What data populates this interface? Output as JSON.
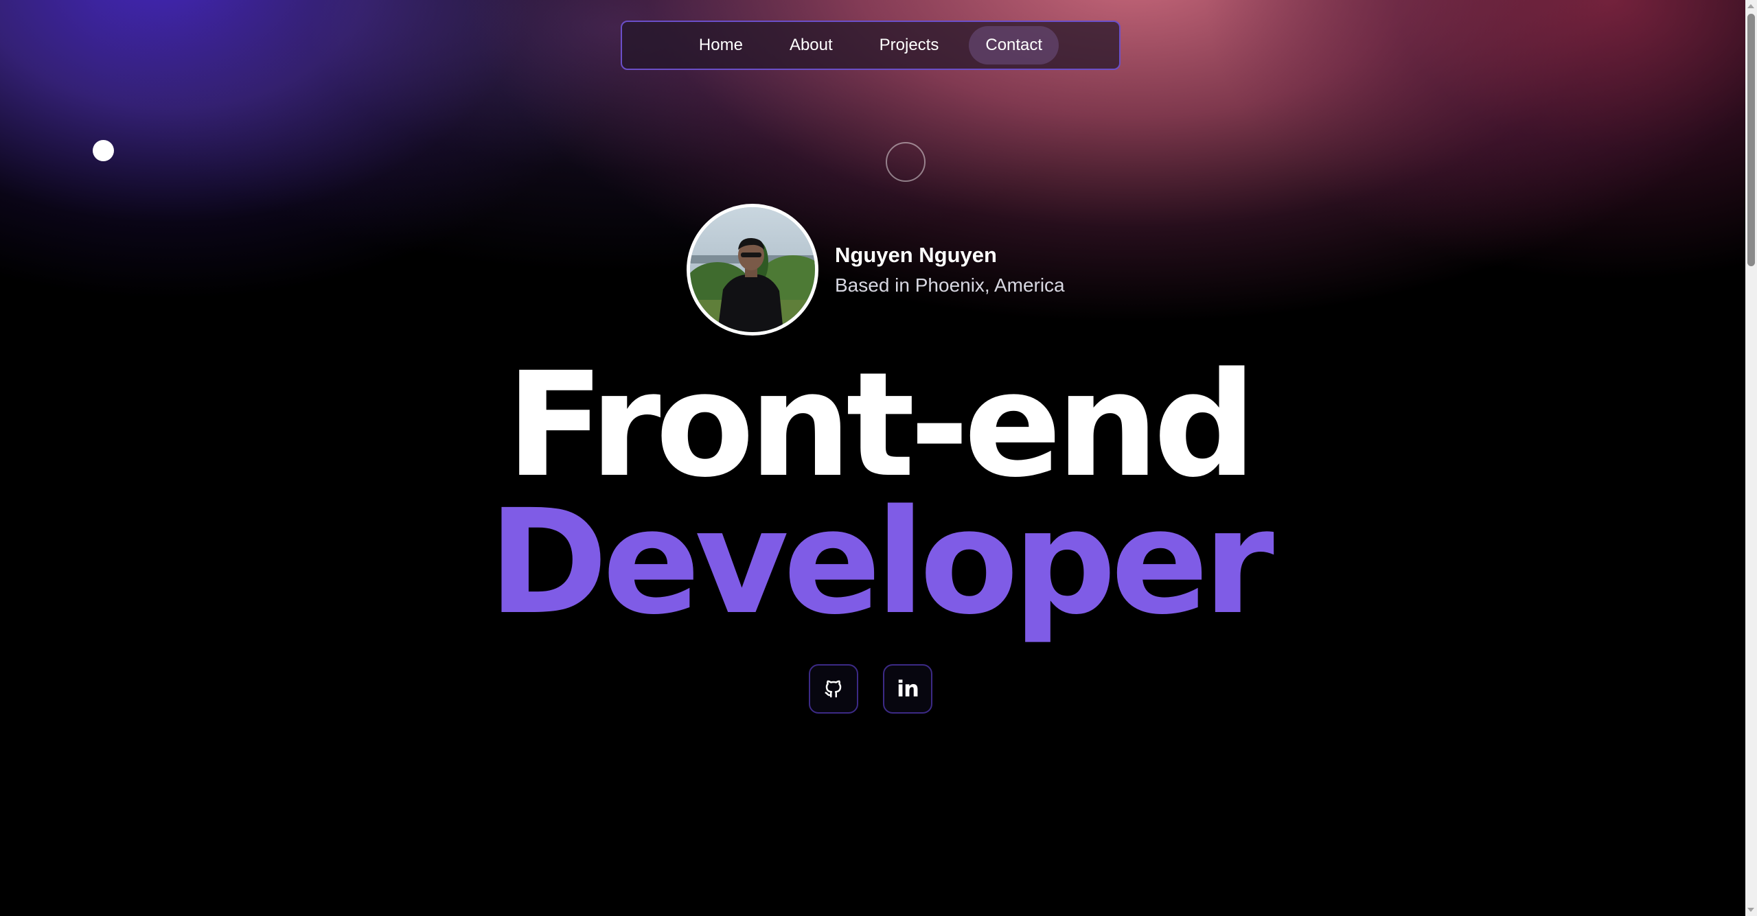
{
  "nav": {
    "items": [
      {
        "label": "Home",
        "active": false
      },
      {
        "label": "About",
        "active": false
      },
      {
        "label": "Projects",
        "active": false
      },
      {
        "label": "Contact",
        "active": true
      }
    ]
  },
  "profile": {
    "name": "Nguyen Nguyen",
    "location": "Based in Phoenix, America",
    "avatar_alt": "profile-photo"
  },
  "hero": {
    "line1": "Front-end",
    "line2": "Developer"
  },
  "social": {
    "github_icon": "github-icon",
    "linkedin_icon": "linkedin-icon",
    "linkedin_glyph": "in"
  },
  "colors": {
    "accent": "#7f5ce6",
    "nav_border": "#6b4fc8",
    "social_border": "#3c2a86",
    "background": "#000000"
  }
}
